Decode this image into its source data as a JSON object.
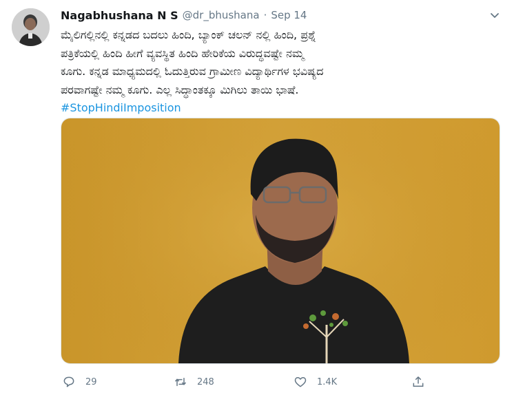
{
  "tweet": {
    "author_name": "Nagabhushana N S",
    "handle": "@dr_bhushana",
    "separator": "·",
    "date": "Sep 14",
    "text_lines": [
      "ಮೈಲಿಗಲ್ಲಿನಲ್ಲಿ ಕನ್ನಡದ ಬದಲು ಹಿಂದಿ, ಬ್ಯಾಂಕ್ ಚಲನ್ ನಲ್ಲಿ ಹಿಂದಿ, ಪ್ರಶ್ನೆ",
      "ಪತ್ರಿಕೆಯಲ್ಲಿ ಹಿಂದಿ ಹೀಗೆ ವ್ಯವಸ್ಥಿತ ಹಿಂದಿ ಹೇರಿಕೆಯ ವಿರುದ್ಧವಷ್ಟೇ ನಮ್ಮ",
      "ಕೂಗು. ಕನ್ನಡ ಮಾಧ್ಯಮದಲ್ಲಿ ಓದುತ್ತಿರುವ ಗ್ರಾಮೀಣ ವಿದ್ಯಾರ್ಥಿಗಳ ಭವಿಷ್ಯದ",
      "ಪರವಾಗಷ್ಟೇ ನಮ್ಮ ಕೂಗು. ಎಲ್ಲ ಸಿದ್ಧಾಂತಕ್ಕೂ ಮಿಗಿಲು ತಾಯಿ ಭಾಷೆ."
    ],
    "hashtag": "#StopHindiImposition"
  },
  "actions": {
    "reply_count": "29",
    "retweet_count": "248",
    "like_count": "1.4K"
  },
  "icons": {
    "reply": "speech-bubble-icon",
    "retweet": "retweet-arrows-icon",
    "like": "heart-icon",
    "share": "share-upload-icon",
    "caret": "chevron-down-icon"
  },
  "colors": {
    "text": "#14171a",
    "muted": "#657786",
    "link": "#1b95e0"
  }
}
